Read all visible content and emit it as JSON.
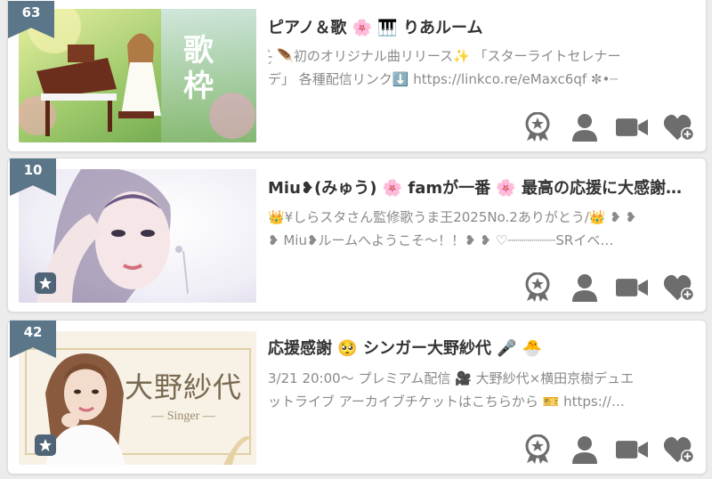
{
  "colors": {
    "ribbon": "#5b7688",
    "icon": "#6d6d6d",
    "desc": "#8a8a8a",
    "title": "#333333"
  },
  "rooms": [
    {
      "rank": "63",
      "title": "ピアノ＆歌 🌸 🎹 りあルーム",
      "desc_line1": "-̗̀ 🪶初のオリジナル曲リリース✨ 「スターライトセレナー",
      "desc_line2": "デ」 各種配信リンク⬇️ https://linkco.re/eMaxc6qf ✼•┈",
      "thumb_text": "歌枠",
      "has_star_badge": false,
      "icons": [
        "award-icon",
        "person-icon",
        "video-icon",
        "heart-plus-icon"
      ]
    },
    {
      "rank": "10",
      "title": "Miu❥(みゅう) 🌸 famが一番 🌸 最高の応援に大感謝…",
      "desc_line1": "👑¥しらスタさん監修歌うま王2025No.2ありがとう/👑 ❥ ❥",
      "desc_line2": "❥ Miu❥ルームへようこそ～！！❥ ❥ ♡┈┈┈┈┈┈SRイベ…",
      "thumb_text": "",
      "has_star_badge": true,
      "icons": [
        "award-icon",
        "person-icon",
        "video-icon",
        "heart-plus-icon"
      ]
    },
    {
      "rank": "42",
      "title": "応援感謝 🥺 シンガー大野紗代 🎤 🐣",
      "desc_line1": "3/21 20:00～ プレミアム配信 🎥 大野紗代×横田京樹デュエ",
      "desc_line2": "ットライブ アーカイブチケットはこちらから 🎫 https://…",
      "thumb_text": "大野紗代",
      "thumb_sub": "— Singer —",
      "has_star_badge": true,
      "icons": [
        "award-icon",
        "person-icon",
        "video-icon",
        "heart-plus-icon"
      ]
    }
  ]
}
